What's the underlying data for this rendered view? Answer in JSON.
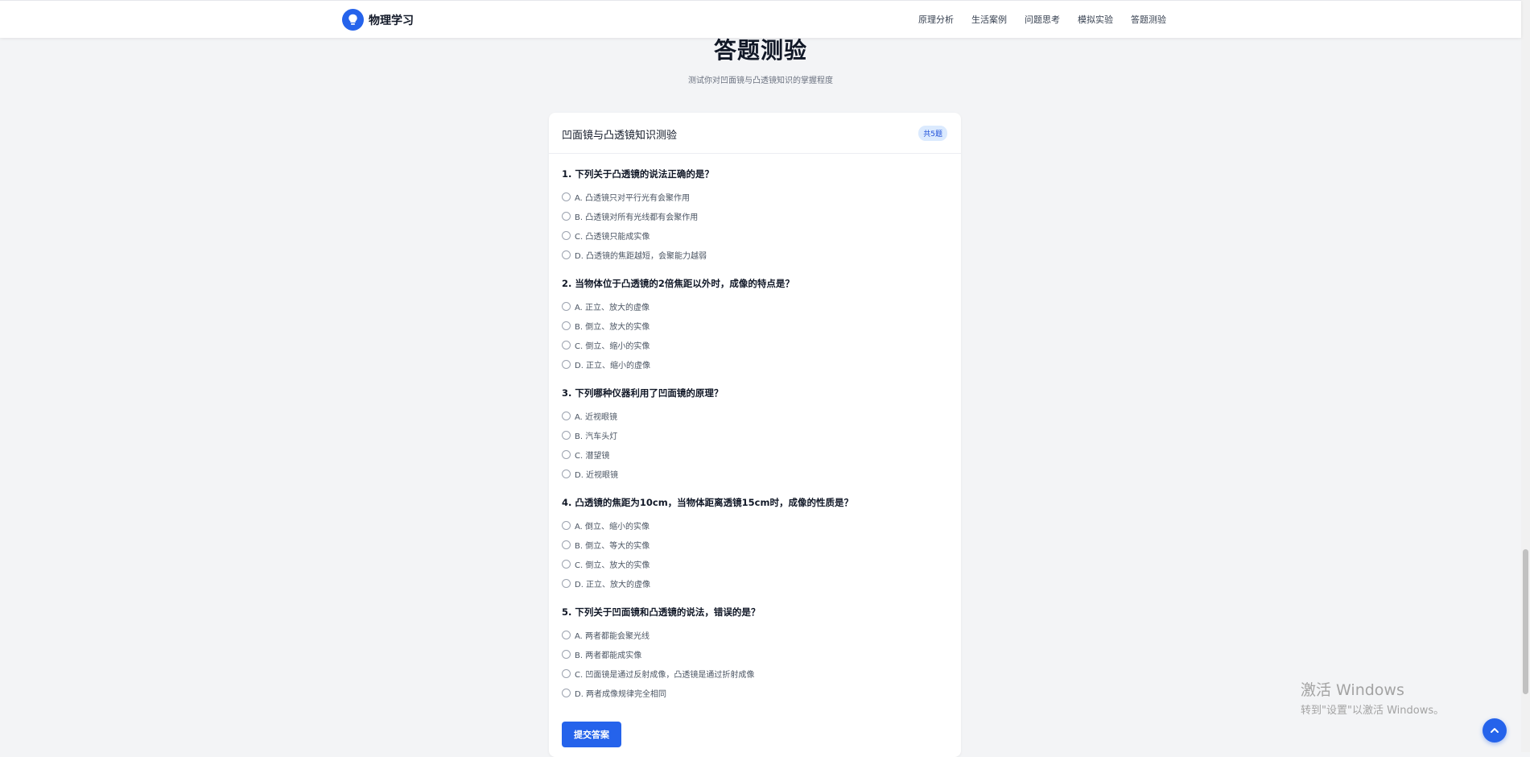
{
  "brand": {
    "name": "物理学习",
    "icon": "lightbulb-icon",
    "accent": "#2563eb"
  },
  "nav": [
    {
      "label": "原理分析"
    },
    {
      "label": "生活案例"
    },
    {
      "label": "问题思考"
    },
    {
      "label": "模拟实验"
    },
    {
      "label": "答题测验"
    }
  ],
  "section": {
    "title": "答题测验",
    "subtitle": "测试你对凹面镜与凸透镜知识的掌握程度"
  },
  "quiz": {
    "title": "凹面镜与凸透镜知识测验",
    "count_badge": "共5题",
    "questions": [
      {
        "title": "1. 下列关于凸透镜的说法正确的是？",
        "options": [
          "A. 凸透镜只对平行光有会聚作用",
          "B. 凸透镜对所有光线都有会聚作用",
          "C. 凸透镜只能成实像",
          "D. 凸透镜的焦距越短，会聚能力越弱"
        ]
      },
      {
        "title": "2. 当物体位于凸透镜的2倍焦距以外时，成像的特点是？",
        "options": [
          "A. 正立、放大的虚像",
          "B. 倒立、放大的实像",
          "C. 倒立、缩小的实像",
          "D. 正立、缩小的虚像"
        ]
      },
      {
        "title": "3. 下列哪种仪器利用了凹面镜的原理？",
        "options": [
          "A. 近视眼镜",
          "B. 汽车头灯",
          "C. 潜望镜",
          "D. 近视眼镜"
        ]
      },
      {
        "title": "4. 凸透镜的焦距为10cm，当物体距离透镜15cm时，成像的性质是？",
        "options": [
          "A. 倒立、缩小的实像",
          "B. 倒立、等大的实像",
          "C. 倒立、放大的实像",
          "D. 正立、放大的虚像"
        ]
      },
      {
        "title": "5. 下列关于凹面镜和凸透镜的说法，错误的是？",
        "options": [
          "A. 两者都能会聚光线",
          "B. 两者都能成实像",
          "C. 凹面镜是通过反射成像，凸透镜是通过折射成像",
          "D. 两者成像规律完全相同"
        ]
      }
    ],
    "submit_label": "提交答案"
  },
  "watermark": {
    "title": "激活 Windows",
    "subtitle": "转到\"设置\"以激活 Windows。"
  },
  "back_to_top_icon": "chevron-up-icon"
}
